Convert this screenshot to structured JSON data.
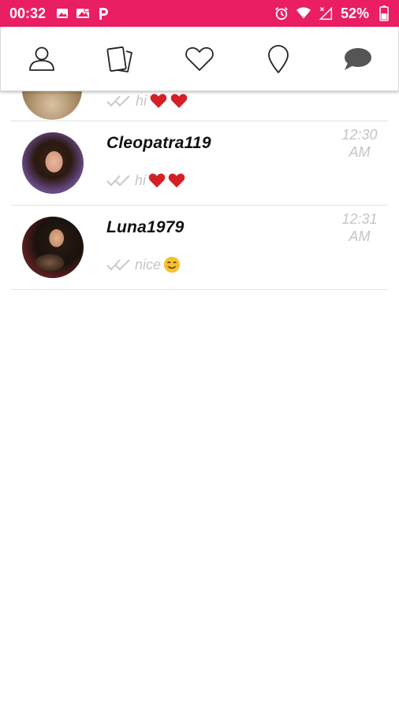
{
  "status_bar": {
    "time": "00:32",
    "battery_percent": "52%",
    "background_color": "#e91e63",
    "left_icons": [
      "image-icon",
      "photo-icon",
      "p-app-icon"
    ],
    "right_icons": [
      "alarm-icon",
      "wifi-icon",
      "signal-icon",
      "battery-icon"
    ]
  },
  "nav": {
    "items": [
      {
        "icon": "profile-icon"
      },
      {
        "icon": "cards-icon"
      },
      {
        "icon": "heart-icon"
      },
      {
        "icon": "location-pin-icon"
      },
      {
        "icon": "chat-icon"
      }
    ]
  },
  "conversations": [
    {
      "username": "",
      "preview": "hi",
      "emojis": [
        "red-heart",
        "red-heart"
      ],
      "time": ""
    },
    {
      "username": "Cleopatra119",
      "preview": "hi",
      "emojis": [
        "red-heart",
        "red-heart"
      ],
      "time_line1": "12:30",
      "time_line2": "AM"
    },
    {
      "username": "Luna1979",
      "preview": "nice",
      "emojis": [
        "smiling-face"
      ],
      "time_line1": "12:31",
      "time_line2": "AM"
    }
  ]
}
